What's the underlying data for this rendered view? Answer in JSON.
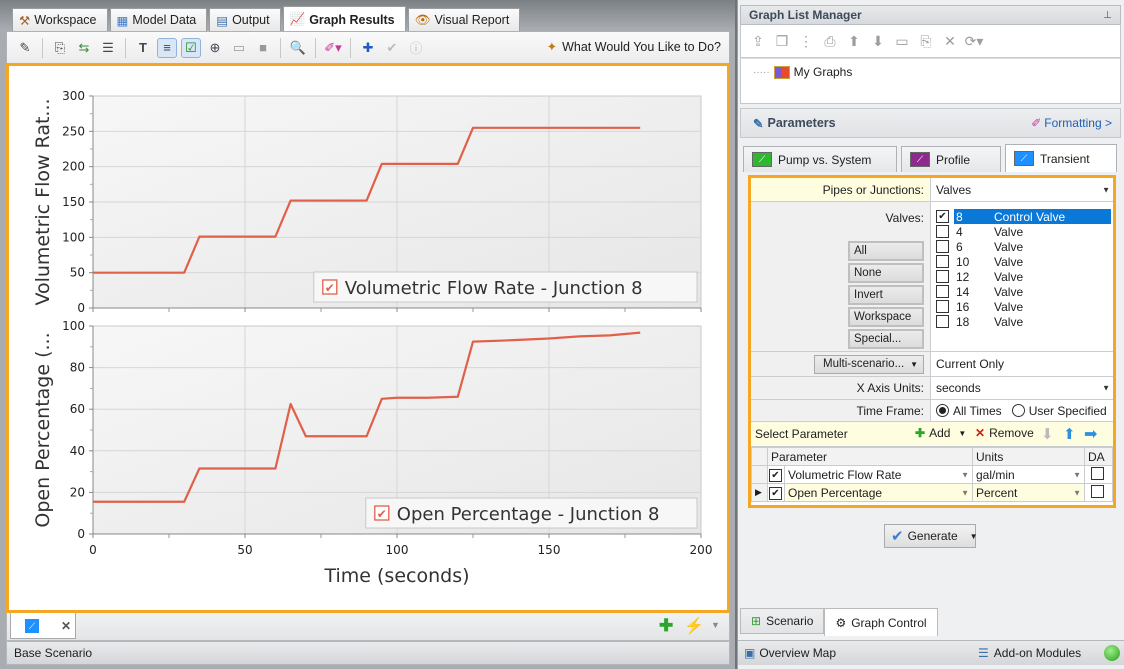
{
  "main_tabs": [
    {
      "label": "Workspace",
      "icon": "hammer-icon",
      "active": false
    },
    {
      "label": "Model Data",
      "icon": "model-data-icon",
      "active": false
    },
    {
      "label": "Output",
      "icon": "table-icon",
      "active": false
    },
    {
      "label": "Graph Results",
      "icon": "graph-icon",
      "active": true
    },
    {
      "label": "Visual Report",
      "icon": "eye-icon",
      "active": false
    }
  ],
  "toolbar": {
    "what_would_you_like": "What Would You Like to Do?"
  },
  "chart_data": [
    {
      "type": "line",
      "title": "",
      "xlabel": "Time (seconds)",
      "ylabel": "Volumetric Flow Rat...",
      "xlim": [
        0,
        200
      ],
      "ylim": [
        0,
        300
      ],
      "xticks": [
        0,
        50,
        100,
        150,
        200
      ],
      "yticks": [
        0,
        50,
        100,
        150,
        200,
        250,
        300
      ],
      "grid": true,
      "legend_position": "bottom-right",
      "series": [
        {
          "name": "Volumetric Flow Rate - Junction 8",
          "color": "#e0604a",
          "x": [
            0,
            30,
            35,
            60,
            65,
            90,
            95,
            120,
            125,
            180
          ],
          "y": [
            50,
            50,
            101,
            101,
            152,
            152,
            204,
            204,
            255,
            255
          ]
        }
      ]
    },
    {
      "type": "line",
      "title": "",
      "xlabel": "Time (seconds)",
      "ylabel": "Open Percentage (...",
      "xlim": [
        0,
        200
      ],
      "ylim": [
        0,
        100
      ],
      "xticks": [
        0,
        50,
        100,
        150,
        200
      ],
      "yticks": [
        0,
        20,
        40,
        60,
        80,
        100
      ],
      "grid": true,
      "legend_position": "bottom-right",
      "series": [
        {
          "name": "Open Percentage - Junction 8",
          "color": "#e0604a",
          "x": [
            0,
            30,
            35,
            60,
            65,
            70,
            90,
            95,
            100,
            110,
            120,
            125,
            135,
            150,
            160,
            170,
            180
          ],
          "y": [
            15.5,
            15.5,
            31.5,
            31.5,
            62.5,
            47,
            47,
            65,
            65.5,
            65.5,
            66,
            92.5,
            93,
            94,
            95,
            95.5,
            96.8
          ]
        }
      ]
    }
  ],
  "bottom": {
    "status": "Base Scenario"
  },
  "graph_list_manager": {
    "title": "Graph List Manager",
    "tree_root": "My Graphs"
  },
  "parameters": {
    "title": "Parameters",
    "formatting_link": "Formatting >",
    "tabs": [
      {
        "label": "Pump vs. System",
        "color": "#2fb82f",
        "active": false
      },
      {
        "label": "Profile",
        "color": "#8e2a8e",
        "active": false
      },
      {
        "label": "Transient",
        "color": "#1e90ff",
        "active": true
      }
    ],
    "pipes_or_junctions_label": "Pipes or Junctions:",
    "pipes_or_junctions_value": "Valves",
    "valves_label": "Valves:",
    "select_buttons": [
      "All",
      "None",
      "Invert",
      "Workspace",
      "Special..."
    ],
    "valves": [
      {
        "id": "8",
        "type": "Control Valve",
        "checked": true,
        "selected": true
      },
      {
        "id": "4",
        "type": "Valve",
        "checked": false,
        "selected": false
      },
      {
        "id": "6",
        "type": "Valve",
        "checked": false,
        "selected": false
      },
      {
        "id": "10",
        "type": "Valve",
        "checked": false,
        "selected": false
      },
      {
        "id": "12",
        "type": "Valve",
        "checked": false,
        "selected": false
      },
      {
        "id": "14",
        "type": "Valve",
        "checked": false,
        "selected": false
      },
      {
        "id": "16",
        "type": "Valve",
        "checked": false,
        "selected": false
      },
      {
        "id": "18",
        "type": "Valve",
        "checked": false,
        "selected": false
      }
    ],
    "multi_scenario_label": "Multi-scenario...",
    "multi_scenario_value": "Current Only",
    "x_axis_units_label": "X Axis Units:",
    "x_axis_units_value": "seconds",
    "time_frame_label": "Time Frame:",
    "time_frame_options": [
      "All Times",
      "User Specified"
    ],
    "time_frame_selected": "All Times",
    "select_parameter_label": "Select Parameter",
    "add_label": "Add",
    "remove_label": "Remove",
    "table_headers": [
      "Parameter",
      "Units",
      "DA"
    ],
    "table_rows": [
      {
        "parameter": "Volumetric Flow Rate",
        "units": "gal/min",
        "checked": true,
        "da": false,
        "current": false
      },
      {
        "parameter": "Open Percentage",
        "units": "Percent",
        "checked": true,
        "da": false,
        "current": true
      }
    ],
    "generate_label": "Generate"
  },
  "right_tabs": [
    {
      "label": "Scenario",
      "active": false
    },
    {
      "label": "Graph Control",
      "active": true
    }
  ],
  "right_status": {
    "overview_map": "Overview Map",
    "addon_modules": "Add-on Modules"
  }
}
